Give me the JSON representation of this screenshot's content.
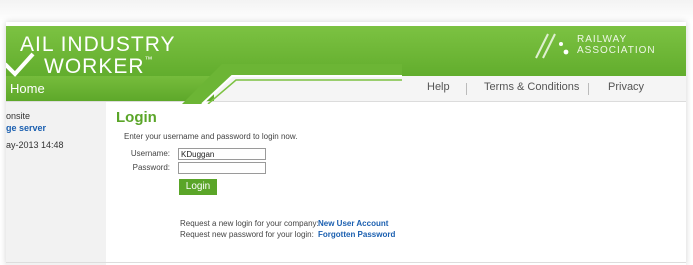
{
  "brand": {
    "line1": "AIL INDUSTRY",
    "line2": "WORKER",
    "tm": "™",
    "assoc_line1": "RAILWAY",
    "assoc_line2": "ASSOCIATION"
  },
  "nav": {
    "home": "Home",
    "links": [
      "Help",
      "Terms & Conditions",
      "Privacy"
    ]
  },
  "sidebar": {
    "line1": "onsite",
    "line2": "ge server",
    "line3": "ay-2013 14:48"
  },
  "login": {
    "title": "Login",
    "instructions": "Enter your username and password to login now.",
    "username_label": "Username:",
    "username_value": "KDuggan",
    "password_label": "Password:",
    "password_value": "",
    "button_label": "Login"
  },
  "requests": [
    {
      "text": "Request a new login for your company:",
      "link": "New User Account"
    },
    {
      "text": "Request new password for your login:",
      "link": "Forgotten Password"
    }
  ],
  "colors": {
    "brand_green": "#6cb535",
    "link_blue": "#1a5fb0",
    "title_green": "#5aa528"
  }
}
